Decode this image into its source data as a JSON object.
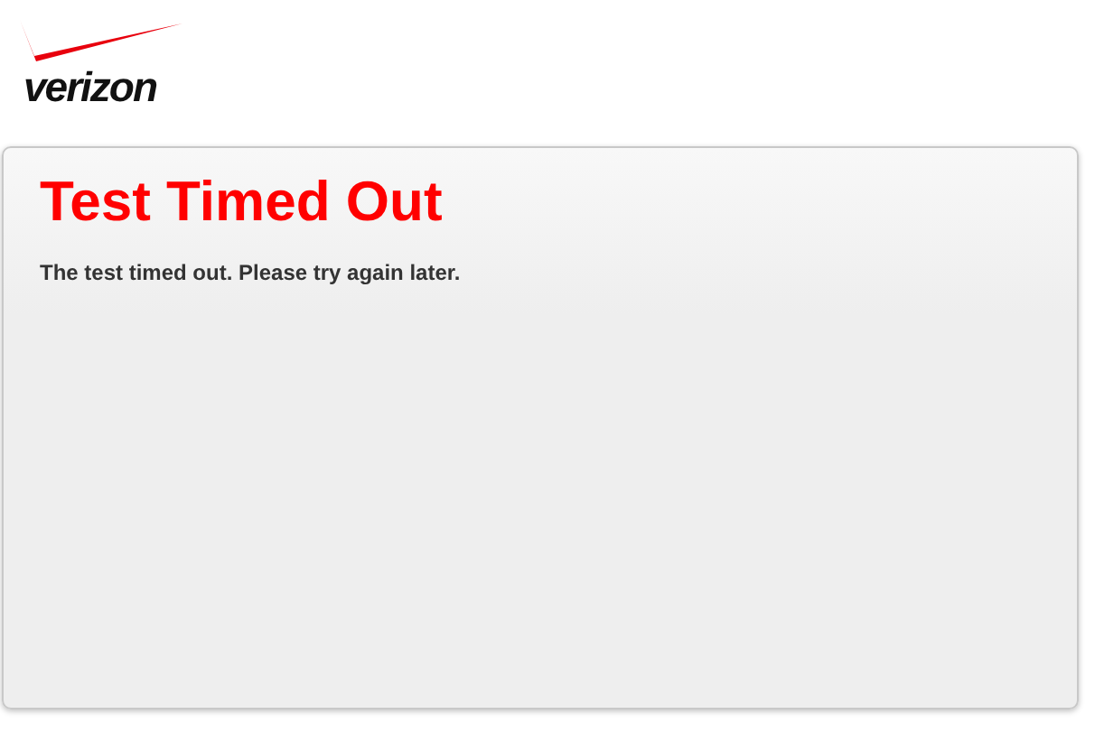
{
  "header": {
    "logo_text": "verizon"
  },
  "panel": {
    "title": "Test Timed Out",
    "message": "The test timed out. Please try again later."
  }
}
